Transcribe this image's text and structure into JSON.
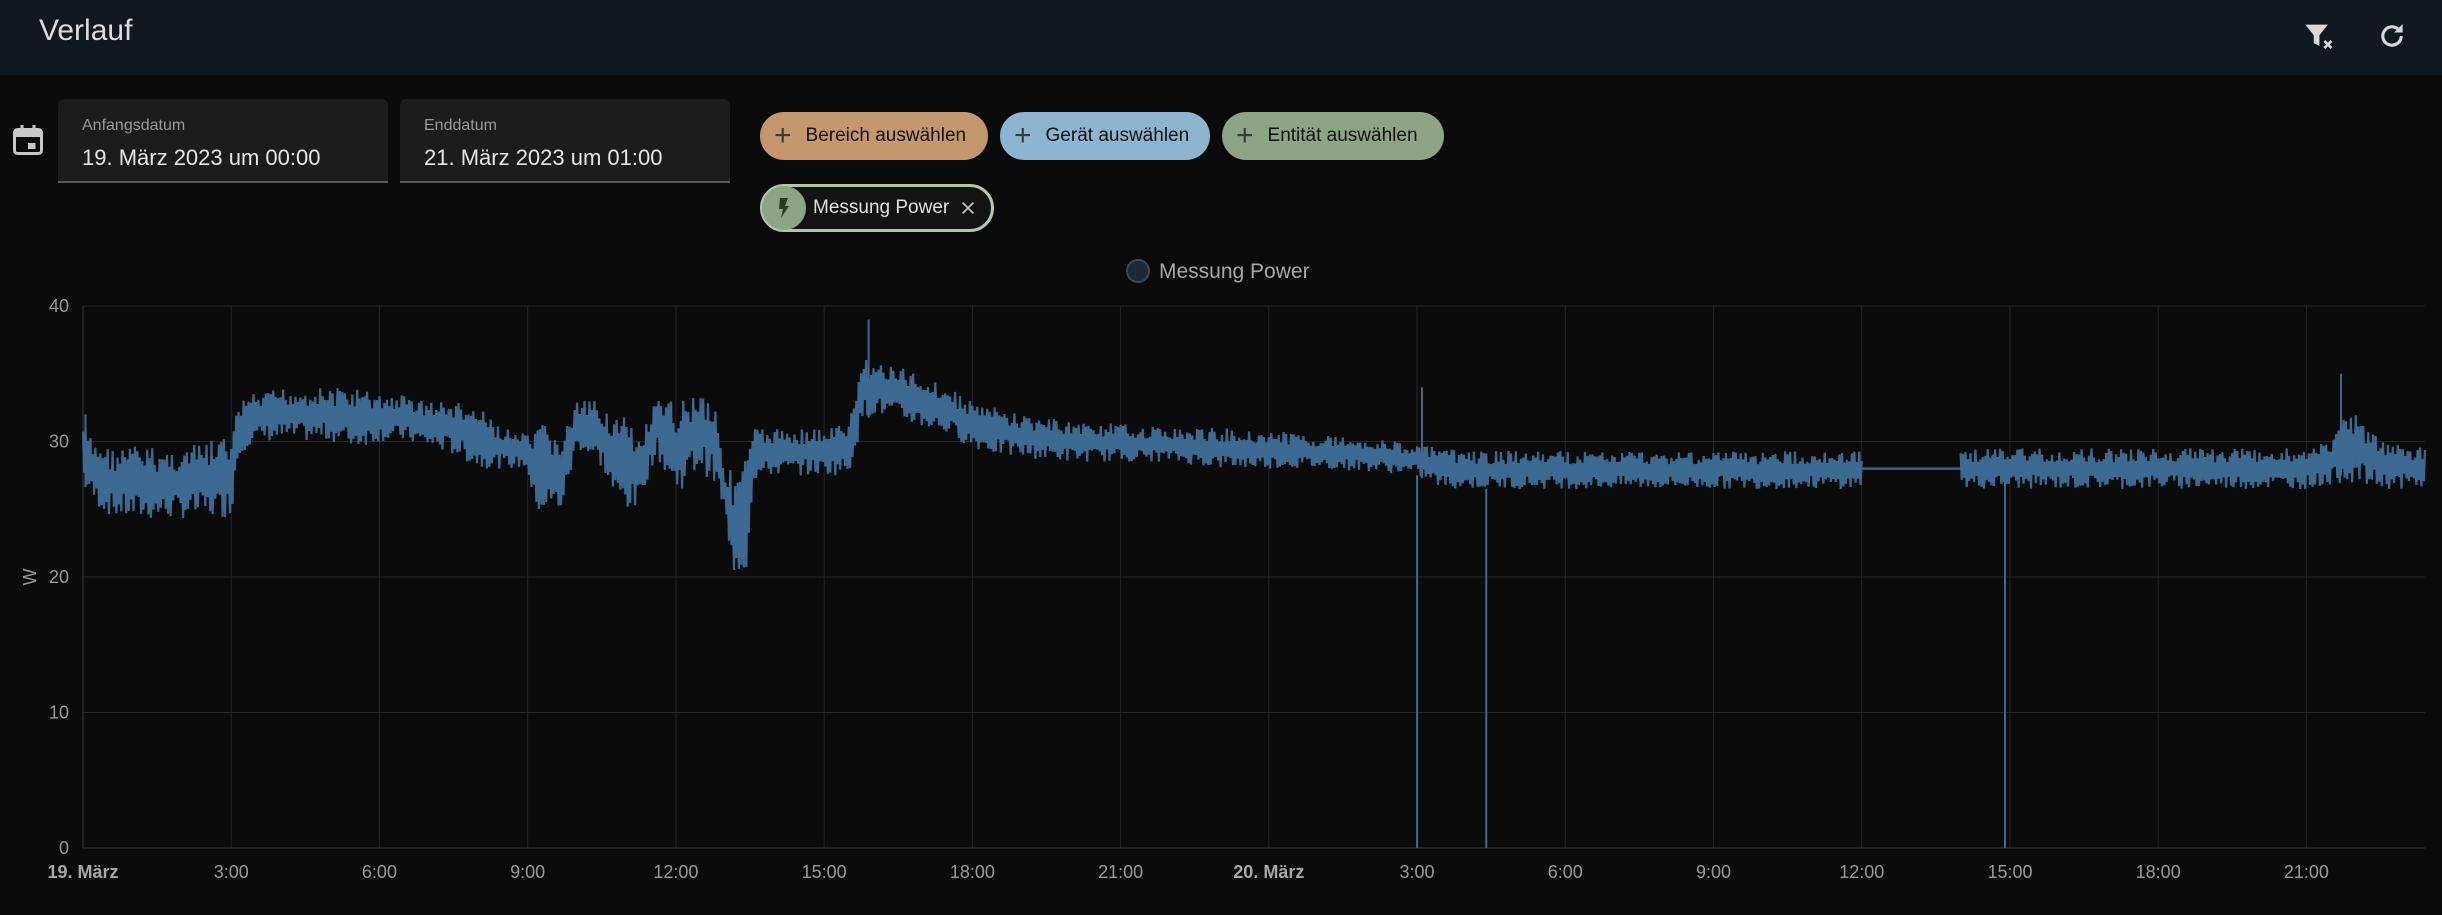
{
  "header": {
    "title": "Verlauf",
    "icons": [
      "filter-remove-icon",
      "refresh-icon"
    ]
  },
  "date_range": {
    "start": {
      "label": "Anfangsdatum",
      "value": "19. März 2023 um 00:00"
    },
    "end": {
      "label": "Enddatum",
      "value": "21. März 2023 um 01:00"
    }
  },
  "target_picker": {
    "area_label": "Bereich auswählen",
    "device_label": "Gerät auswählen",
    "entity_label": "Entität auswählen"
  },
  "selected_entity": {
    "label": "Messung Power",
    "icon": "flash-icon"
  },
  "colors": {
    "series": "#3d6a93",
    "area_chip": "#c4976f",
    "device_chip": "#8cb5d0",
    "entity_chip": "#8da485",
    "header_bg": "#101820"
  },
  "chart_data": {
    "type": "line",
    "legend": [
      "Messung Power"
    ],
    "legend_position": "top-center",
    "ylabel": "W",
    "ylim": [
      0,
      40
    ],
    "yticks": [
      0,
      10,
      20,
      30,
      40
    ],
    "grid": true,
    "xlim_hours": [
      0,
      47.4
    ],
    "xticks": [
      {
        "h": 0,
        "label": "19. März",
        "bold": true
      },
      {
        "h": 3,
        "label": "3:00"
      },
      {
        "h": 6,
        "label": "6:00"
      },
      {
        "h": 9,
        "label": "9:00"
      },
      {
        "h": 12,
        "label": "12:00"
      },
      {
        "h": 15,
        "label": "15:00"
      },
      {
        "h": 18,
        "label": "18:00"
      },
      {
        "h": 21,
        "label": "21:00"
      },
      {
        "h": 24,
        "label": "20. März",
        "bold": true
      },
      {
        "h": 27,
        "label": "3:00"
      },
      {
        "h": 30,
        "label": "6:00"
      },
      {
        "h": 33,
        "label": "9:00"
      },
      {
        "h": 36,
        "label": "12:00"
      },
      {
        "h": 39,
        "label": "15:00"
      },
      {
        "h": 42,
        "label": "18:00"
      },
      {
        "h": 45,
        "label": "21:00"
      }
    ],
    "series": [
      {
        "name": "Messung Power",
        "band_hours": [
          0,
          0.2,
          0.4,
          0.6,
          1,
          1.6,
          2,
          2.5,
          3,
          3.1,
          3.2,
          3.3,
          3.6,
          4,
          4.5,
          5,
          5.5,
          6,
          6.5,
          7,
          7.5,
          8,
          8.5,
          9,
          9.1,
          9.3,
          9.7,
          10,
          10.5,
          10.8,
          11,
          11.2,
          11.6,
          12,
          12.5,
          12.8,
          13,
          13.1,
          13.3,
          13.45,
          13.55,
          14,
          14.5,
          15,
          15.5,
          15.6,
          15.8,
          16,
          16.5,
          17,
          17.5,
          18,
          18.5,
          19,
          20,
          21,
          22,
          23,
          24,
          25,
          26,
          27,
          27.5,
          28,
          29,
          30,
          31,
          32,
          33,
          34,
          35,
          36
        ],
        "band_low": [
          27,
          25.5,
          24.8,
          24.4,
          24.2,
          24.2,
          24.3,
          24.3,
          24.4,
          28,
          29,
          29.5,
          30,
          30,
          30,
          30,
          29.5,
          30,
          30,
          29.5,
          29,
          28,
          28,
          28,
          25,
          24.5,
          24.8,
          29.5,
          28,
          25,
          25,
          24.8,
          29,
          26,
          28,
          26.5,
          24.5,
          20.2,
          20.2,
          20.2,
          27,
          27.5,
          27.5,
          27.5,
          27.5,
          29,
          31.5,
          32,
          31.5,
          31,
          30.5,
          29.5,
          29,
          28.8,
          28.5,
          28.5,
          28.5,
          28,
          28,
          28,
          27.8,
          27.5,
          26.5,
          26.5,
          26.5,
          26.5,
          26.5,
          26.5,
          26.5,
          26.5,
          26.5,
          26.5
        ],
        "band_high": [
          31.5,
          30,
          30,
          29.5,
          29.8,
          29.5,
          29.5,
          30,
          30.5,
          32,
          33,
          33.5,
          33.5,
          34,
          34,
          34,
          34,
          33.5,
          33.5,
          33,
          33,
          32.5,
          31,
          30.5,
          30.5,
          31.5,
          30.5,
          33,
          33,
          32,
          32,
          30,
          33,
          33,
          34,
          33,
          28,
          28,
          28,
          29.5,
          31,
          31,
          31,
          31,
          31.5,
          33,
          36.5,
          36,
          35.5,
          35,
          34,
          33,
          32.5,
          32,
          31.5,
          31.3,
          31,
          31,
          30.8,
          30.5,
          30.3,
          29.8,
          29.5,
          29.3,
          29.3,
          29.3,
          29.3,
          29.3,
          29.3,
          29.3,
          29.3,
          29.3
        ],
        "band2_hours": [
          38,
          39,
          40,
          41,
          42,
          43,
          44,
          45,
          45.5,
          45.8,
          46,
          46.5,
          47.4
        ],
        "band2_low": [
          26.5,
          26.5,
          26.5,
          26.5,
          26.5,
          26.5,
          26.5,
          26.5,
          26.8,
          27,
          26.8,
          26.5,
          26.5
        ],
        "band2_high": [
          29.5,
          29.5,
          29.5,
          29.5,
          29.5,
          29.5,
          29.5,
          29.5,
          30,
          33,
          32,
          30,
          29.5
        ],
        "gap_line": {
          "from_h": 36,
          "to_h": 38,
          "value": 28
        },
        "spikes": [
          {
            "h": 0.05,
            "value": 32
          },
          {
            "h": 15.9,
            "value": 39
          },
          {
            "h": 27.1,
            "value": 34
          },
          {
            "h": 45.7,
            "value": 35
          },
          {
            "h": 27,
            "value": 0
          },
          {
            "h": 28.4,
            "value": 0
          },
          {
            "h": 38.9,
            "value": 0
          }
        ]
      }
    ]
  }
}
